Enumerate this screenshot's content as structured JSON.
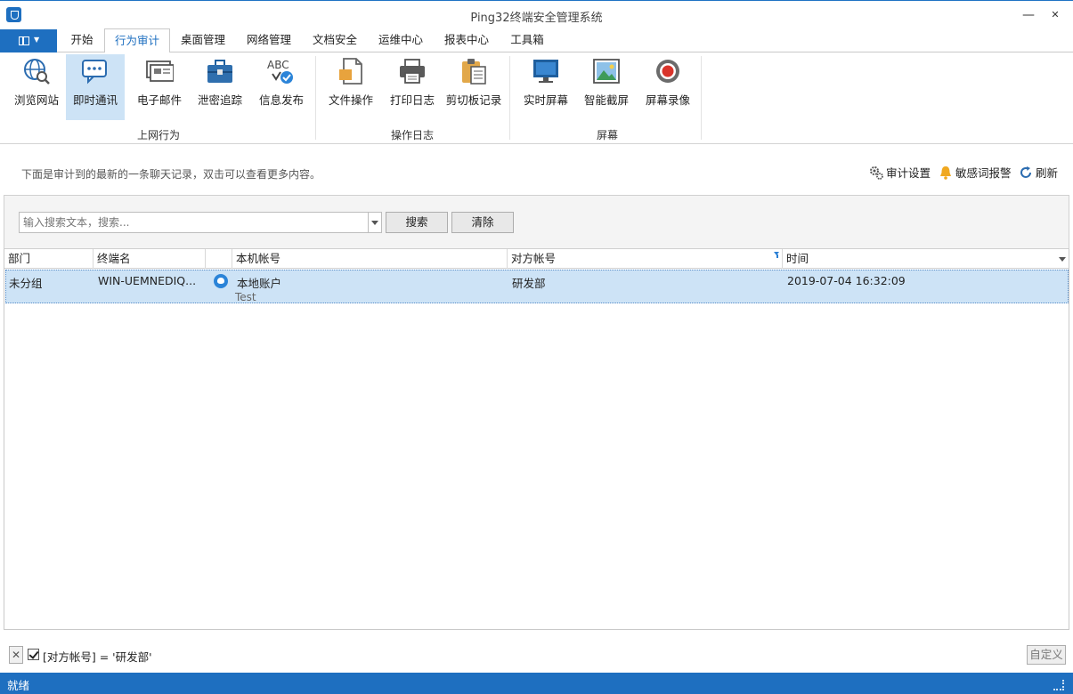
{
  "window": {
    "title": "Ping32终端安全管理系统",
    "minimize": "—",
    "maximize": "☐",
    "close": "✕"
  },
  "tabs": [
    "开始",
    "行为审计",
    "桌面管理",
    "网络管理",
    "文档安全",
    "运维中心",
    "报表中心",
    "工具箱"
  ],
  "active_tab": "行为审计",
  "ribbon": {
    "groups": [
      {
        "label": "上网行为",
        "buttons": [
          "浏览网站",
          "即时通讯",
          "电子邮件",
          "泄密追踪",
          "信息发布"
        ]
      },
      {
        "label": "操作日志",
        "buttons": [
          "文件操作",
          "打印日志",
          "剪切板记录"
        ]
      },
      {
        "label": "屏幕",
        "buttons": [
          "实时屏幕",
          "智能截屏",
          "屏幕录像"
        ]
      }
    ],
    "selected": "即时通讯",
    "icon_text_abc": "ABC"
  },
  "info": {
    "text": "下面是审计到的最新的一条聊天记录，双击可以查看更多内容。",
    "links": [
      "审计设置",
      "敏感词报警",
      "刷新"
    ]
  },
  "search": {
    "placeholder": "输入搜索文本，搜索...",
    "search_label": "搜索",
    "clear_label": "清除"
  },
  "grid": {
    "columns": [
      "部门",
      "终端名",
      "",
      "本机帐号",
      "对方帐号",
      "时间"
    ],
    "rows": [
      {
        "dept": "未分组",
        "terminal": "WIN-UEMNEDIQ...",
        "local_account": "本地账户",
        "remote_account": "研发部",
        "time": "2019-07-04 16:32:09",
        "message": "Test"
      }
    ]
  },
  "filter": {
    "close": "✕",
    "text": "[对方帐号] = '研发部'",
    "custom_label": "自定义"
  },
  "status": {
    "text": "就绪"
  },
  "colors": {
    "accent": "#1e6fc0",
    "selection": "#cde3f6"
  }
}
